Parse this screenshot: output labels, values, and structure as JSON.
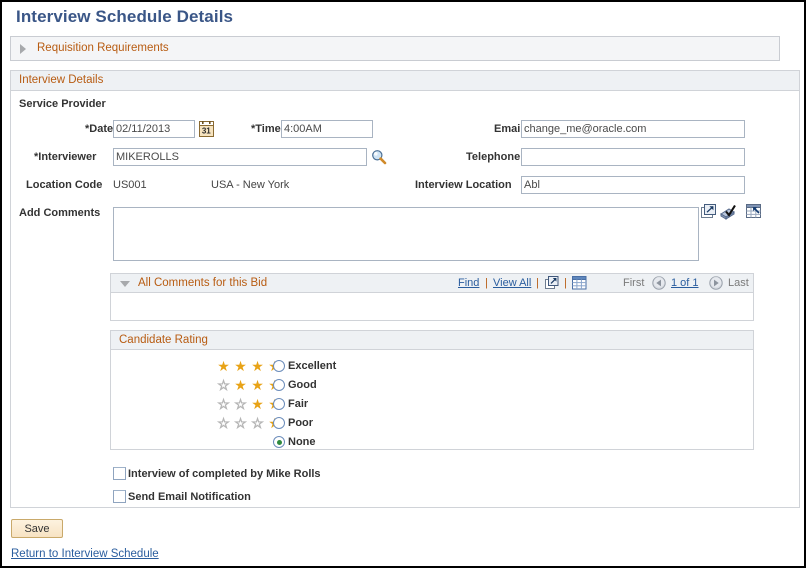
{
  "page": {
    "title": "Interview Schedule Details"
  },
  "collapse_section": {
    "label": "Requisition Requirements",
    "icon": "triangle-right-icon"
  },
  "interview_details": {
    "group_label": "Interview Details",
    "service_provider_label": "Service Provider",
    "fields": {
      "date_label": "*Date",
      "date_value": "02/11/2013",
      "calendar_icon": "calendar-icon",
      "calendar_icon_text": "31",
      "time_label": "*Time",
      "time_value": "4:00AM",
      "interviewer_label": "*Interviewer",
      "interviewer_value": "MIKEROLLS",
      "lookup_icon": "magnifier-lookup-icon",
      "location_code_label": "Location Code",
      "location_code_value": "US001",
      "location_description": "USA - New York",
      "email_label": "Email",
      "email_value": "change_me@oracle.com",
      "telephone_label": "Telephone",
      "telephone_value": "",
      "interview_location_label": "Interview Location",
      "interview_location_value": "Abl",
      "add_comments_label": "Add Comments",
      "add_comments_value": ""
    },
    "comment_tools": [
      {
        "name": "expand-popup-icon",
        "title": "Expand"
      },
      {
        "name": "spell-check-icon",
        "title": "Spell Check"
      },
      {
        "name": "grid-lookup-icon",
        "title": "Multi Row Insert"
      }
    ]
  },
  "all_comments": {
    "title": "All Comments for this Bid",
    "collapse_icon": "triangle-down-icon",
    "find_label": "Find",
    "view_all_label": "View All",
    "sep1": "|",
    "sep2": "|",
    "sep3": "|",
    "download_icon": "download-popup-icon",
    "grid_icon": "grid-view-icon",
    "first_label": "First",
    "prev_icon": "prev-arrow-icon",
    "counter": "1 of 1",
    "next_icon": "next-arrow-icon",
    "last_label": "Last"
  },
  "candidate_rating": {
    "title": "Candidate Rating",
    "options": [
      {
        "label": "Excellent",
        "stars": 4,
        "filled": 4,
        "selected": false
      },
      {
        "label": "Good",
        "stars": 4,
        "filled": 3,
        "selected": false
      },
      {
        "label": "Fair",
        "stars": 4,
        "filled": 2,
        "selected": false
      },
      {
        "label": "Poor",
        "stars": 4,
        "filled": 1,
        "selected": false
      },
      {
        "label": "None",
        "stars": 0,
        "filled": 0,
        "selected": true
      }
    ]
  },
  "checkboxes": [
    {
      "label": "Interview of completed by Mike Rolls",
      "checked": false
    },
    {
      "label": "Send Email Notification",
      "checked": false
    }
  ],
  "actions": {
    "save_label": "Save",
    "return_link": "Return to Interview Schedule"
  },
  "colors": {
    "title_blue": "#3a5687",
    "header_orange": "#b85c12",
    "link_blue": "#2a5d9e",
    "star_gold": "#e8a317",
    "radio_green": "#2f8a3f",
    "panel_bg": "#eef1f4",
    "border_gray": "#d0d3d8",
    "input_border": "#a9b4c2"
  }
}
